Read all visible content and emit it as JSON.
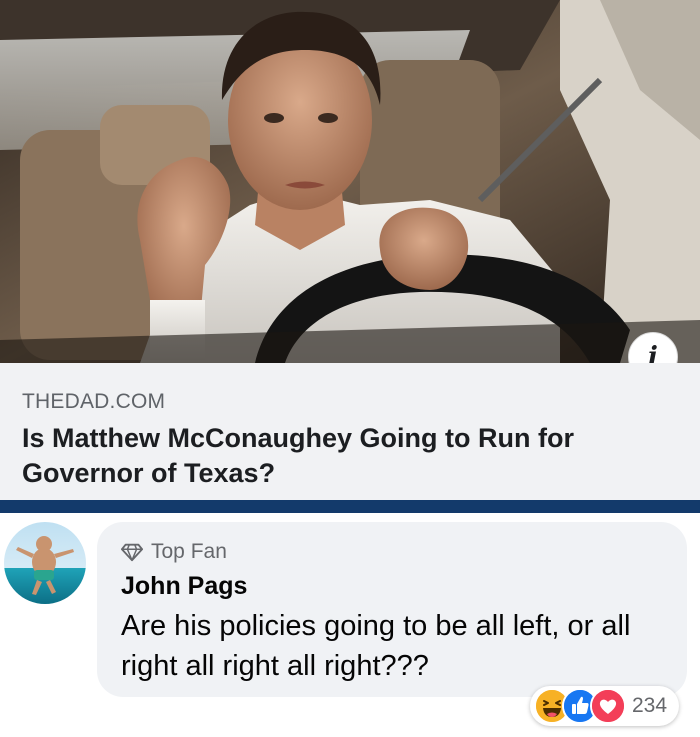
{
  "link_preview": {
    "domain": "THEDAD.COM",
    "title": "Is Matthew McConaughey Going to Run for Governor of Texas?",
    "info_icon": "info-icon"
  },
  "comment": {
    "badge_label": "Top Fan",
    "badge_icon": "diamond-icon",
    "author": "John Pags",
    "text": "Are his policies going to be all left, or all right all right all right???",
    "reactions": {
      "icons": [
        "haha-icon",
        "like-icon",
        "love-icon"
      ],
      "count": "234"
    }
  },
  "colors": {
    "divider": "#133a6b",
    "like": "#1877f2",
    "love": "#f33e58",
    "haha": "#f7b125"
  }
}
